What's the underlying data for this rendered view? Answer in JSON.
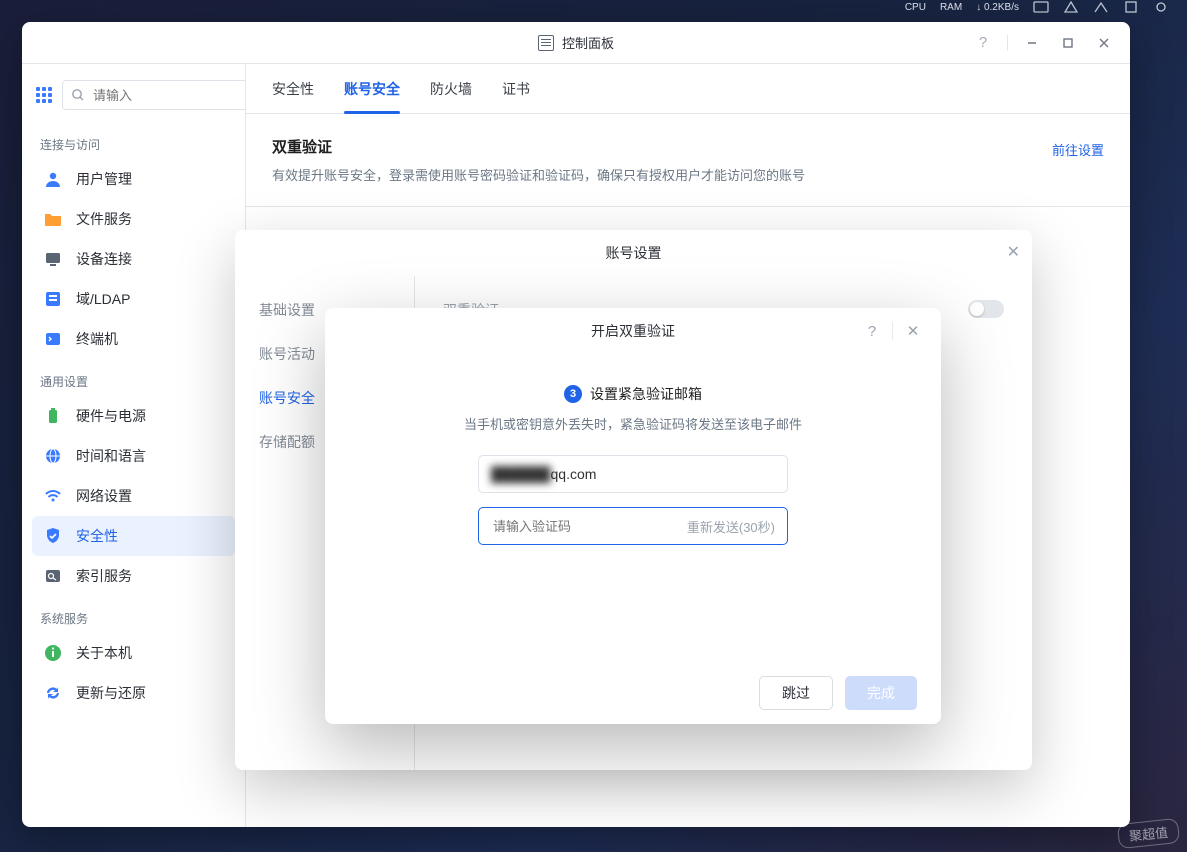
{
  "sysbar": {
    "cpu": "CPU",
    "ram": "RAM",
    "net": "↓ 0.2KB/s"
  },
  "window": {
    "title": "控制面板"
  },
  "sidebar": {
    "search_placeholder": "请输入",
    "groups": [
      {
        "title": "连接与访问",
        "items": [
          {
            "label": "用户管理"
          },
          {
            "label": "文件服务"
          },
          {
            "label": "设备连接"
          },
          {
            "label": "域/LDAP"
          },
          {
            "label": "终端机"
          }
        ]
      },
      {
        "title": "通用设置",
        "items": [
          {
            "label": "硬件与电源"
          },
          {
            "label": "时间和语言"
          },
          {
            "label": "网络设置"
          },
          {
            "label": "安全性"
          },
          {
            "label": "索引服务"
          }
        ]
      },
      {
        "title": "系统服务",
        "items": [
          {
            "label": "关于本机"
          },
          {
            "label": "更新与还原"
          }
        ]
      }
    ]
  },
  "tabs": [
    "安全性",
    "账号安全",
    "防火墙",
    "证书"
  ],
  "section": {
    "title": "双重验证",
    "desc": "有效提升账号安全，登录需使用账号密码验证和验证码，确保只有授权用户才能访问您的账号",
    "link": "前往设置"
  },
  "modal1": {
    "title": "账号设置",
    "side": [
      "基础设置",
      "账号活动",
      "账号安全",
      "存储配额"
    ],
    "row_label": "双重验证"
  },
  "modal2": {
    "title": "开启双重验证",
    "step_num": "3",
    "step_title": "设置紧急验证邮箱",
    "step_desc": "当手机或密钥意外丢失时，紧急验证码将发送至该电子邮件",
    "email_masked": "██████",
    "email_rest": "qq.com",
    "code_placeholder": "请输入验证码",
    "resend": "重新发送(30秒)",
    "skip": "跳过",
    "done": "完成"
  },
  "watermark": "聚超值"
}
